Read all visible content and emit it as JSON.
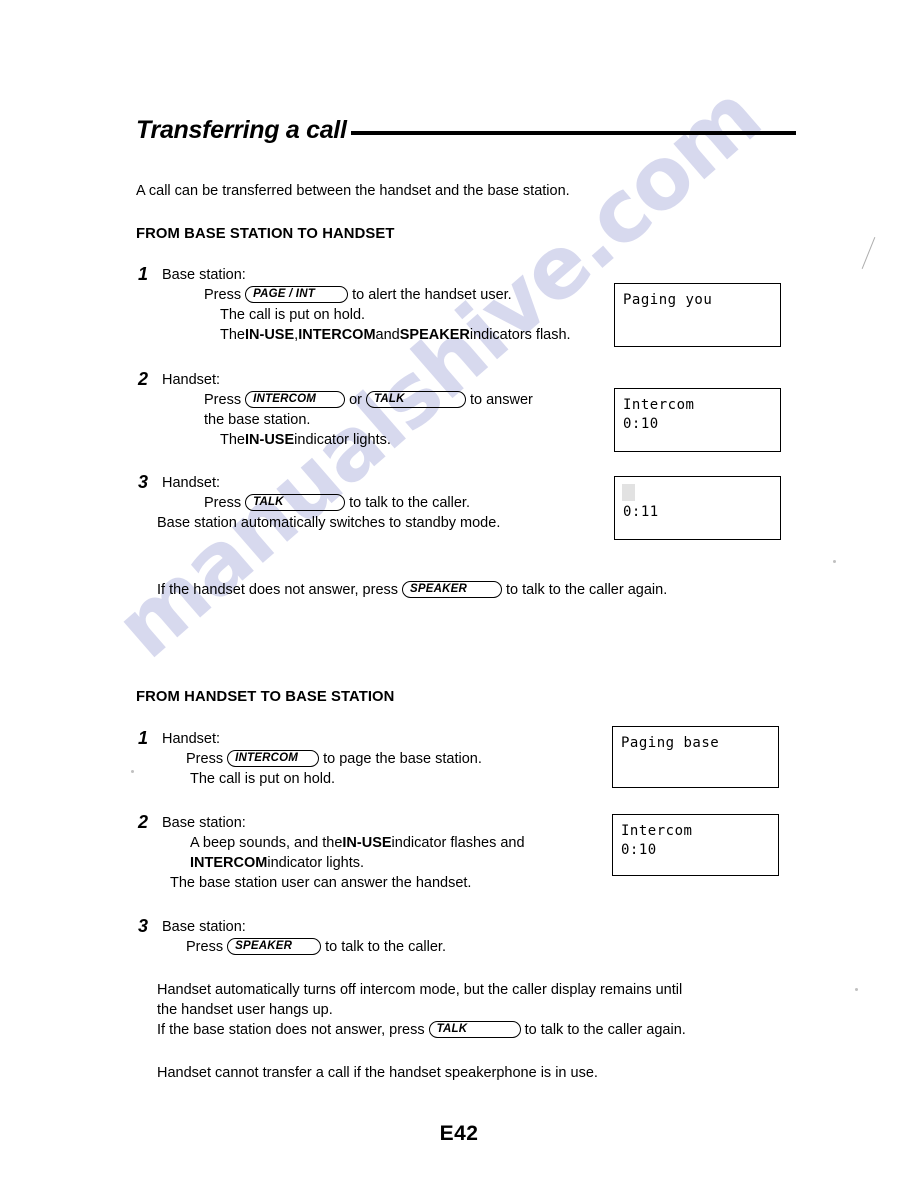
{
  "document": {
    "title": "Transferring a call",
    "intro": "A call can be transferred between the handset and the base station.",
    "page_number": "E42",
    "watermark": "manualshive.com"
  },
  "section1": {
    "heading": "FROM BASE STATION TO HANDSET",
    "steps": [
      {
        "number": "1",
        "role": "Base station:",
        "press_label": "Press",
        "key": "PAGE / INT",
        "after_key": "to alert the handset user.",
        "note1": "The call is put on hold.",
        "note2_pre": "The ",
        "note2_b1": "IN-USE",
        "note2_mid1": ", ",
        "note2_b2": "INTERCOM",
        "note2_mid2": " and ",
        "note2_b3": "SPEAKER",
        "note2_post": " indicators flash."
      },
      {
        "number": "2",
        "role": "Handset:",
        "press_label": "Press",
        "key": "INTERCOM",
        "conjunction": "or",
        "key2": "TALK",
        "after_key": "to answer",
        "cont": "the base station.",
        "note1_pre": "The ",
        "note1_b": "IN-USE",
        "note1_post": " indicator lights."
      },
      {
        "number": "3",
        "role": "Handset:",
        "press_label": "Press",
        "key": "TALK",
        "after_key": "to talk to the caller.",
        "note1": "Base station automatically switches to standby mode."
      }
    ],
    "footnote": {
      "pre": "If the handset does not answer, press",
      "key": "SPEAKER",
      "post": "to talk to the caller again."
    },
    "displays": [
      {
        "line1": "Paging you",
        "line2": ""
      },
      {
        "line1": "Intercom",
        "line2": "0:10"
      },
      {
        "line1": "",
        "line2": "0:11"
      }
    ]
  },
  "section2": {
    "heading": "FROM HANDSET TO BASE STATION",
    "steps": [
      {
        "number": "1",
        "role": "Handset:",
        "press_label": "Press",
        "key": "INTERCOM",
        "after_key": "to page the base station.",
        "note1": "The call is put on hold."
      },
      {
        "number": "2",
        "role": "Base station:",
        "note1_pre": "A beep sounds, and the ",
        "note1_b": "IN-USE",
        "note1_post": " indicator flashes and",
        "note2_b": "INTERCOM",
        "note2_post": " indicator lights.",
        "note3": "The base station user can answer the handset."
      },
      {
        "number": "3",
        "role": "Base station:",
        "press_label": "Press",
        "key": "SPEAKER",
        "after_key": "to talk to the caller."
      }
    ],
    "closing": {
      "line1": "Handset automatically turns off intercom mode, but the caller display remains until",
      "line2": "the handset user hangs up.",
      "line3_pre": "If the base station does not answer, press",
      "line3_key": "TALK",
      "line3_post": "to talk to the caller again.",
      "line4": "Handset cannot transfer a call if the handset speakerphone is in use."
    },
    "displays": [
      {
        "line1": "Paging base",
        "line2": ""
      },
      {
        "line1": "Intercom",
        "line2": "0:10"
      }
    ]
  }
}
